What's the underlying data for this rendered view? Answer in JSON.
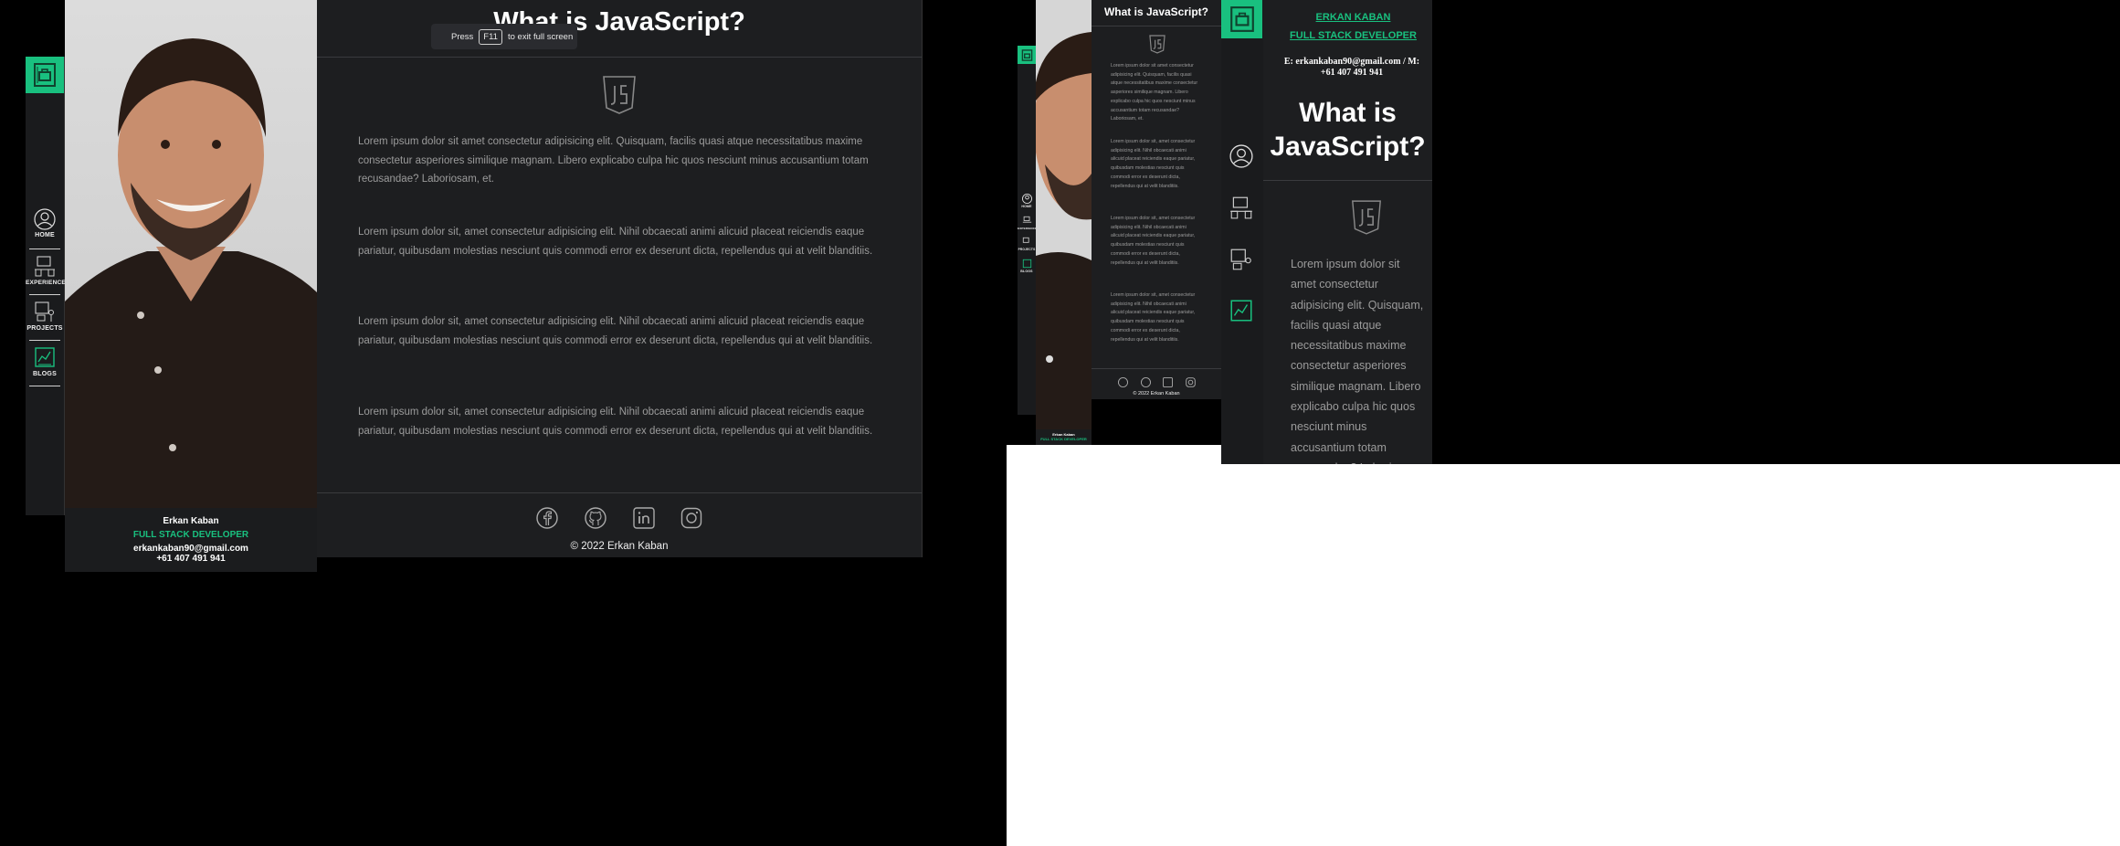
{
  "profile": {
    "name": "Erkan Kaban",
    "name_upper": "ERKAN KABAN",
    "role": "FULL STACK DEVELOPER",
    "email": "erkankaban90@gmail.com",
    "phone": "+61 407 491 941",
    "contact_line": "E: erkankaban90@gmail.com / M: +61 407 491 941"
  },
  "nav": {
    "items": [
      {
        "label": "HOME",
        "icon": "user-circle-icon"
      },
      {
        "label": "EXPERIENCE",
        "icon": "desk-computer-icon"
      },
      {
        "label": "PROJECTS",
        "icon": "project-board-icon"
      },
      {
        "label": "BLOGS",
        "icon": "blog-chart-icon"
      }
    ]
  },
  "article": {
    "title": "What is JavaScript?",
    "paragraphs": [
      "Lorem ipsum dolor sit amet consectetur adipisicing elit. Quisquam, facilis quasi atque necessitatibus maxime consectetur asperiores similique magnam. Libero explicabo culpa hic quos nesciunt minus accusantium totam recusandae? Laboriosam, et.",
      "Lorem ipsum dolor sit, amet consectetur adipisicing elit. Nihil obcaecati animi alicuid placeat reiciendis eaque pariatur, quibusdam molestias nesciunt quis commodi error ex deserunt dicta, repellendus qui at velit blanditiis.",
      "Lorem ipsum dolor sit, amet consectetur adipisicing elit. Nihil obcaecati animi alicuid placeat reiciendis eaque pariatur, quibusdam molestias nesciunt quis commodi error ex deserunt dicta, repellendus qui at velit blanditiis.",
      "Lorem ipsum dolor sit, amet consectetur adipisicing elit. Nihil obcaecati animi alicuid placeat reiciendis eaque pariatur, quibusdam molestias nesciunt quis commodi error ex deserunt dicta, repellendus qui at velit blanditiis."
    ],
    "mobile_paragraph": "Lorem ipsum dolor sit amet consectetur adipisicing elit. Quisquam, facilis quasi atque necessitatibus maxime consectetur asperiores similique magnam. Libero explicabo culpa hic quos nesciunt minus accusantium totam recusandae? Laboriosam, et."
  },
  "footer": {
    "copyright": "© 2022 Erkan Kaban",
    "socials": [
      "facebook-icon",
      "github-icon",
      "linkedin-icon",
      "instagram-icon"
    ]
  },
  "fullscreen_notice": {
    "press": "Press",
    "key": "F11",
    "suffix": "to exit full screen"
  },
  "colors": {
    "accent": "#19c07f",
    "panel": "#1d1e20",
    "background": "#000000"
  }
}
